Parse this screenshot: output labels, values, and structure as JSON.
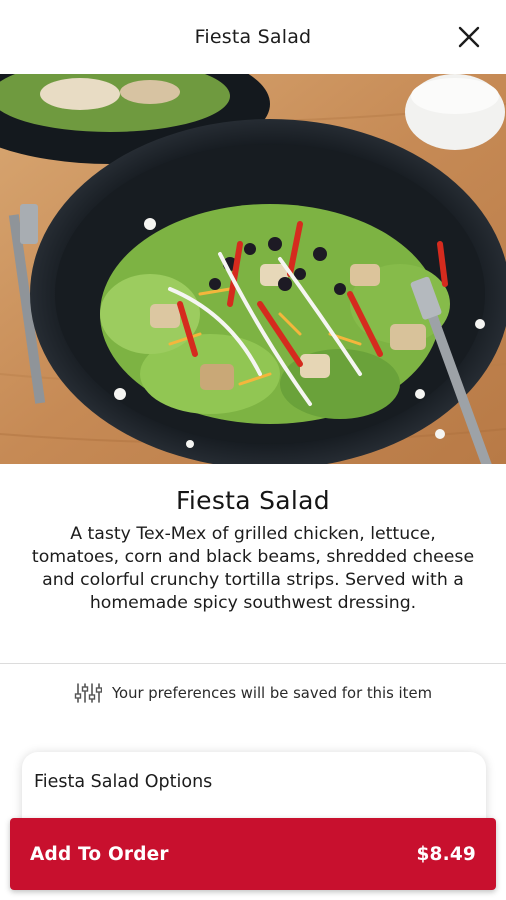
{
  "header": {
    "title": "Fiesta Salad",
    "close_icon": "close-icon"
  },
  "hero": {
    "image": "fiesta-salad-photo"
  },
  "item": {
    "title": "Fiesta Salad",
    "description": "A tasty Tex-Mex of grilled chicken, lettuce, tomatoes, corn and black beams, shredded cheese and colorful crunchy tortilla strips. Served with a homemade spicy southwest dressing."
  },
  "preferences": {
    "icon": "sliders-icon",
    "text": "Your preferences will be saved for this item"
  },
  "options": {
    "title": "Fiesta Salad Options"
  },
  "order": {
    "label": "Add To Order",
    "price": "$8.49"
  },
  "colors": {
    "brand": "#c8102e",
    "text": "#1c1c1c",
    "divider": "#dcdcdc"
  }
}
